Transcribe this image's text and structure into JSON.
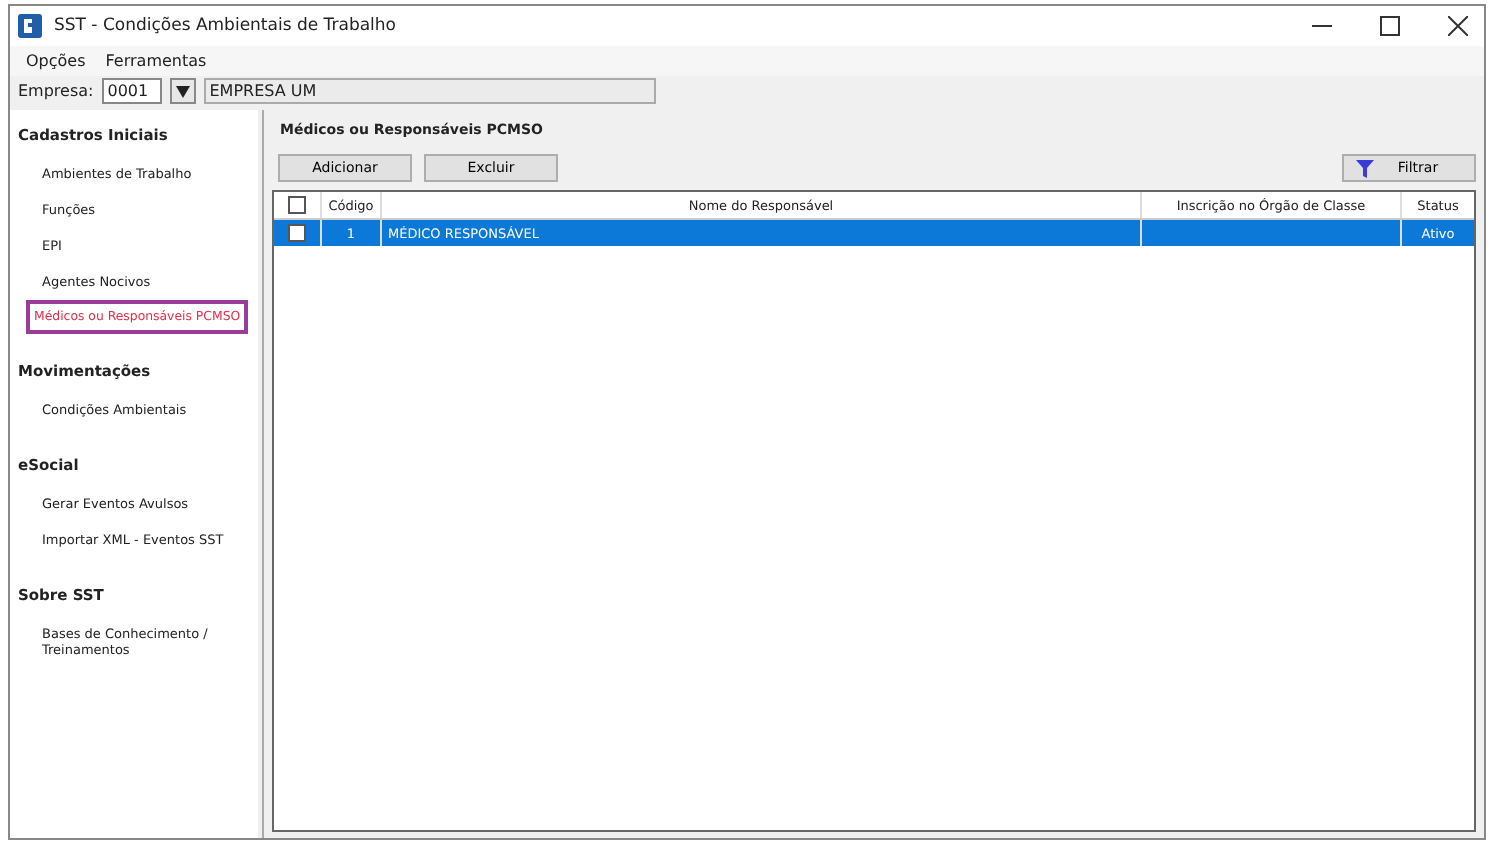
{
  "window": {
    "title": "SST - Condições Ambientais de Trabalho"
  },
  "menu": [
    "Opções",
    "Ferramentas"
  ],
  "empresa": {
    "label": "Empresa:",
    "code": "0001",
    "name": "EMPRESA UM"
  },
  "sidebar": [
    {
      "heading": "Cadastros Iniciais",
      "items": [
        {
          "label": "Ambientes de Trabalho",
          "selected": false
        },
        {
          "label": "Funções",
          "selected": false
        },
        {
          "label": "EPI",
          "selected": false
        },
        {
          "label": "Agentes Nocivos",
          "selected": false
        },
        {
          "label": "Médicos ou Responsáveis PCMSO",
          "selected": true
        }
      ]
    },
    {
      "heading": "Movimentações",
      "items": [
        {
          "label": "Condições Ambientais",
          "selected": false
        }
      ]
    },
    {
      "heading": "eSocial",
      "items": [
        {
          "label": "Gerar Eventos Avulsos",
          "selected": false
        },
        {
          "label": "Importar XML - Eventos SST",
          "selected": false
        }
      ]
    },
    {
      "heading": "Sobre SST",
      "items": [
        {
          "label": "Bases de Conhecimento / Treinamentos",
          "selected": false
        }
      ]
    }
  ],
  "content": {
    "title": "Médicos ou Responsáveis PCMSO",
    "buttons": [
      "Adicionar",
      "Excluir"
    ],
    "filter": "Filtrar"
  },
  "table": {
    "all_checked": false,
    "columns": [
      "Código",
      "Nome do Responsável",
      "Inscrição no Órgão de Classe",
      "Status"
    ],
    "rows": [
      {
        "checked": false,
        "selected": true,
        "cells": [
          "1",
          "MÉDICO RESPONSÁVEL",
          "",
          "Ativo"
        ]
      }
    ]
  }
}
